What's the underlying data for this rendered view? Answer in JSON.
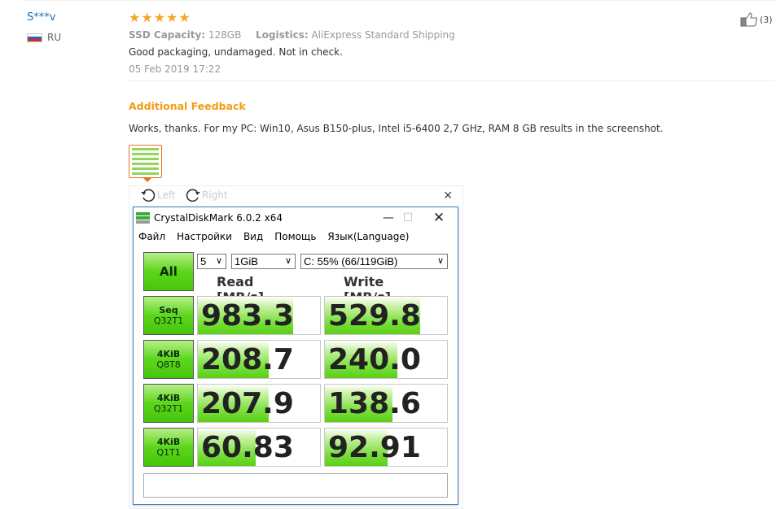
{
  "review": {
    "user": {
      "name": "S***v",
      "country": "RU"
    },
    "rating": {
      "stars": 5,
      "max": 5
    },
    "attributes": [
      {
        "label": "SSD Capacity:",
        "value": "128GB"
      },
      {
        "label": "Logistics:",
        "value": "AliExpress Standard Shipping"
      }
    ],
    "text": "Good packaging, undamaged. Not in check.",
    "date": "05 Feb 2019 17:22",
    "helpful_count": "(3)",
    "additional_feedback": {
      "heading": "Additional Feedback",
      "text": "Works, thanks. For my PC: Win10, Asus B150-plus, Intel i5-6400 2,7 GHz, RAM 8 GB results in the screenshot."
    }
  },
  "viewer": {
    "rotate_left_label": "Left",
    "rotate_right_label": "Right",
    "close_glyph": "✕"
  },
  "crystaldiskmark": {
    "title": "CrystalDiskMark 6.0.2 x64",
    "menu": [
      "Файл",
      "Настройки",
      "Вид",
      "Помощь",
      "Язык(Language)"
    ],
    "all_button": "All",
    "count_select": "5",
    "size_select": "1GiB",
    "drive_select": "C: 55% (66/119GiB)",
    "read_header": "Read [MB/s]",
    "write_header": "Write [MB/s]",
    "tests": [
      {
        "line1": "Seq",
        "line2": "Q32T1",
        "read": "983.3",
        "write": "529.8",
        "read_fill": 0.78,
        "write_fill": 0.78
      },
      {
        "line1": "4KiB",
        "line2": "Q8T8",
        "read": "208.7",
        "write": "240.0",
        "read_fill": 0.58,
        "write_fill": 0.59
      },
      {
        "line1": "4KiB",
        "line2": "Q32T1",
        "read": "207.9",
        "write": "138.6",
        "read_fill": 0.58,
        "write_fill": 0.55
      },
      {
        "line1": "4KiB",
        "line2": "Q1T1",
        "read": "60.83",
        "write": "92.91",
        "read_fill": 0.47,
        "write_fill": 0.51
      }
    ],
    "status_text": ""
  },
  "colors": {
    "accent_orange": "#f39c12",
    "link_blue": "#1a6dbb",
    "star": "#f5a623",
    "bar_green": "#5ad016"
  }
}
